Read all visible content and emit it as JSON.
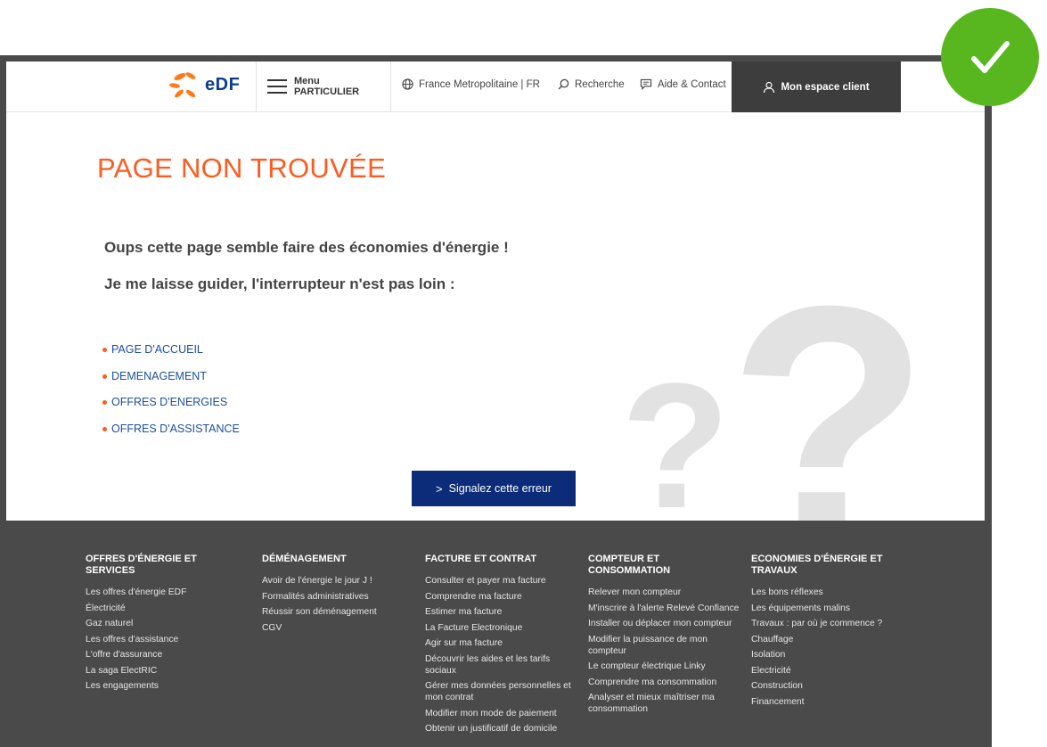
{
  "header": {
    "logo_text": "eDF",
    "menu_label": "Menu",
    "menu_sub": "PARTICULIER",
    "region": "France Metropolitaine | FR",
    "search": "Recherche",
    "help": "Aide & Contact",
    "account": "Mon espace client"
  },
  "main": {
    "title": "PAGE NON TROUVÉE",
    "lead1": "Oups cette page semble faire des économies d'énergie !",
    "lead2": "Je me laisse guider, l'interrupteur n'est pas loin :",
    "links": [
      "PAGE D'ACCUEIL",
      "DEMENAGEMENT",
      "OFFRES D'ENERGIES",
      "OFFRES D'ASSISTANCE"
    ],
    "report_button": "Signalez cette erreur",
    "background_glyph": "?"
  },
  "footer": {
    "columns": [
      {
        "title": "OFFRES D'ÉNERGIE ET SERVICES",
        "items": [
          "Les offres d'énergie EDF",
          "Électricité",
          "Gaz naturel",
          "Les offres d'assistance",
          "L'offre d'assurance",
          "La saga ElectRIC",
          "Les engagements"
        ]
      },
      {
        "title": "DÉMÉNAGEMENT",
        "items": [
          "Avoir de l'énergie le jour J !",
          "Formalités administratives",
          "Réussir son déménagement",
          "CGV"
        ]
      },
      {
        "title": "FACTURE ET CONTRAT",
        "items": [
          "Consulter et payer ma facture",
          "Comprendre ma facture",
          "Estimer ma facture",
          "La Facture Electronique",
          "Agir sur ma facture",
          "Découvrir les aides et les tarifs sociaux",
          "Gérer mes données personnelles et mon contrat",
          "Modifier mon mode de paiement",
          "Obtenir un justificatif de domicile"
        ]
      },
      {
        "title": "COMPTEUR ET CONSOMMATION",
        "items": [
          "Relever mon compteur",
          "M'inscrire à l'alerte Relevé Confiance",
          "Installer ou déplacer mon compteur",
          "Modifier la puissance de mon compteur",
          "Le compteur électrique Linky",
          "Comprendre ma consommation",
          "Analyser et mieux maîtriser ma consommation"
        ]
      },
      {
        "title": "ECONOMIES D'ÉNERGIE ET TRAVAUX",
        "items": [
          "Les bons réflexes",
          "Les équipements malins",
          "Travaux : par où je commence ?",
          "Chauffage",
          "Isolation",
          "Electricité",
          "Construction",
          "Financement"
        ]
      }
    ]
  },
  "colors": {
    "accent_orange": "#ff5a1f",
    "edf_blue": "#0c3d8c",
    "button_navy": "#0c2b78",
    "footer_bg": "#4a4a4a",
    "check_green": "#58b71f"
  }
}
